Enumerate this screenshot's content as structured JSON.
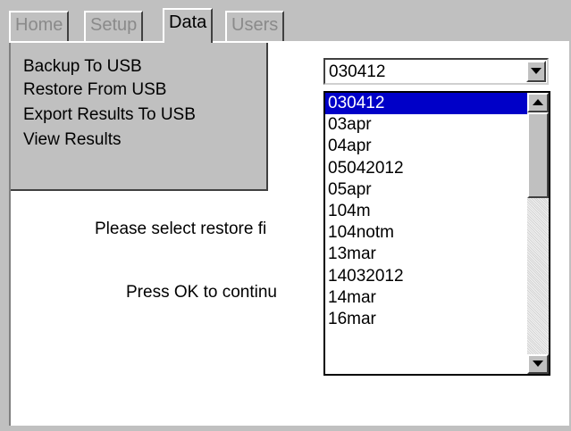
{
  "tabs": [
    {
      "label": "Home",
      "active": false
    },
    {
      "label": "Setup",
      "active": false
    },
    {
      "label": "Data",
      "active": true
    },
    {
      "label": "Users",
      "active": false
    }
  ],
  "data_menu": {
    "items": [
      "Backup To USB",
      "Restore From USB",
      "Export Results To USB",
      "View Results"
    ]
  },
  "messages": {
    "select_prompt": "Please select restore fi",
    "continue_prompt": "Press OK to continu"
  },
  "restore_file_combo": {
    "selected_value": "030412",
    "options": [
      "030412",
      "03apr",
      "04apr",
      "05042012",
      "05apr",
      "104m",
      "104notm",
      "13mar",
      "14032012",
      "14mar",
      "16mar"
    ],
    "highlighted_index": 0
  },
  "icons": {
    "combo_button": "chevron-down-icon",
    "scroll_up": "arrow-up-icon",
    "scroll_down": "arrow-down-icon"
  },
  "colors": {
    "selection": "#0000c8",
    "chrome": "#c0c0c0"
  }
}
